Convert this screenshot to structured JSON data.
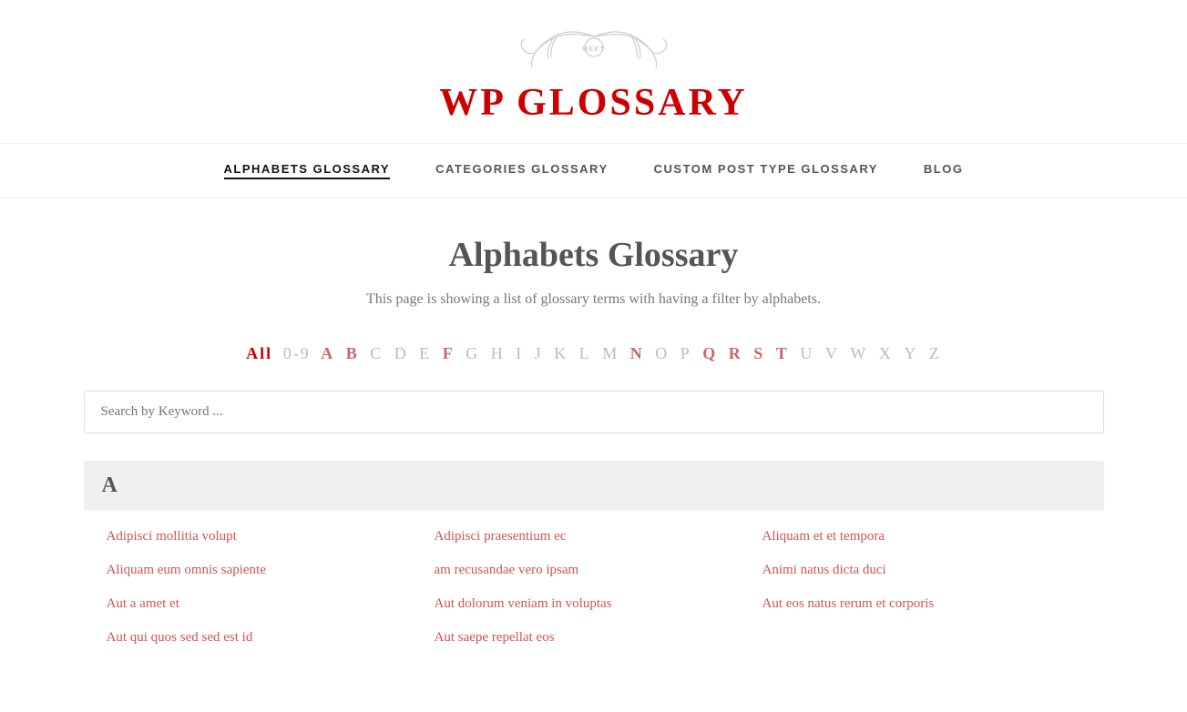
{
  "header": {
    "logo_meet": "MEET",
    "logo_title": "WP GLOSSARY"
  },
  "nav": {
    "items": [
      {
        "label": "ALPHABETS GLOSSARY",
        "active": true
      },
      {
        "label": "CATEGORIES GLOSSARY",
        "active": false
      },
      {
        "label": "CUSTOM POST TYPE GLOSSARY",
        "active": false
      },
      {
        "label": "BLOG",
        "active": false
      }
    ]
  },
  "main": {
    "page_title": "Alphabets Glossary",
    "page_description": "This page is showing a list of glossary terms with having a filter by alphabets.",
    "search_placeholder": "Search by Keyword ..."
  },
  "alphabet_nav": {
    "all_label": "All",
    "items": [
      {
        "letter": "0-9",
        "state": "normal"
      },
      {
        "letter": "A",
        "state": "has-content"
      },
      {
        "letter": "B",
        "state": "has-content"
      },
      {
        "letter": "C",
        "state": "normal"
      },
      {
        "letter": "D",
        "state": "normal"
      },
      {
        "letter": "E",
        "state": "normal"
      },
      {
        "letter": "F",
        "state": "has-content"
      },
      {
        "letter": "G",
        "state": "normal"
      },
      {
        "letter": "H",
        "state": "normal"
      },
      {
        "letter": "I",
        "state": "normal"
      },
      {
        "letter": "J",
        "state": "normal"
      },
      {
        "letter": "K",
        "state": "normal"
      },
      {
        "letter": "L",
        "state": "normal"
      },
      {
        "letter": "M",
        "state": "normal"
      },
      {
        "letter": "N",
        "state": "has-content"
      },
      {
        "letter": "O",
        "state": "normal"
      },
      {
        "letter": "P",
        "state": "normal"
      },
      {
        "letter": "Q",
        "state": "has-content"
      },
      {
        "letter": "R",
        "state": "has-content"
      },
      {
        "letter": "S",
        "state": "has-content"
      },
      {
        "letter": "T",
        "state": "has-content"
      },
      {
        "letter": "U",
        "state": "normal"
      },
      {
        "letter": "V",
        "state": "normal"
      },
      {
        "letter": "W",
        "state": "normal"
      },
      {
        "letter": "X",
        "state": "normal"
      },
      {
        "letter": "Y",
        "state": "normal"
      },
      {
        "letter": "Z",
        "state": "normal"
      }
    ]
  },
  "sections": [
    {
      "letter": "A",
      "terms": [
        "Adipisci mollitia volupt",
        "Adipisci praesentium ec",
        "Aliquam et et tempora",
        "Aliquam eum omnis sapiente",
        "am recusandae vero ipsam",
        "Animi natus dicta duci",
        "Aut a amet et",
        "Aut dolorum veniam in voluptas",
        "Aut eos natus rerum et corporis",
        "Aut qui quos sed sed est id",
        "Aut saepe repellat eos",
        ""
      ]
    }
  ]
}
